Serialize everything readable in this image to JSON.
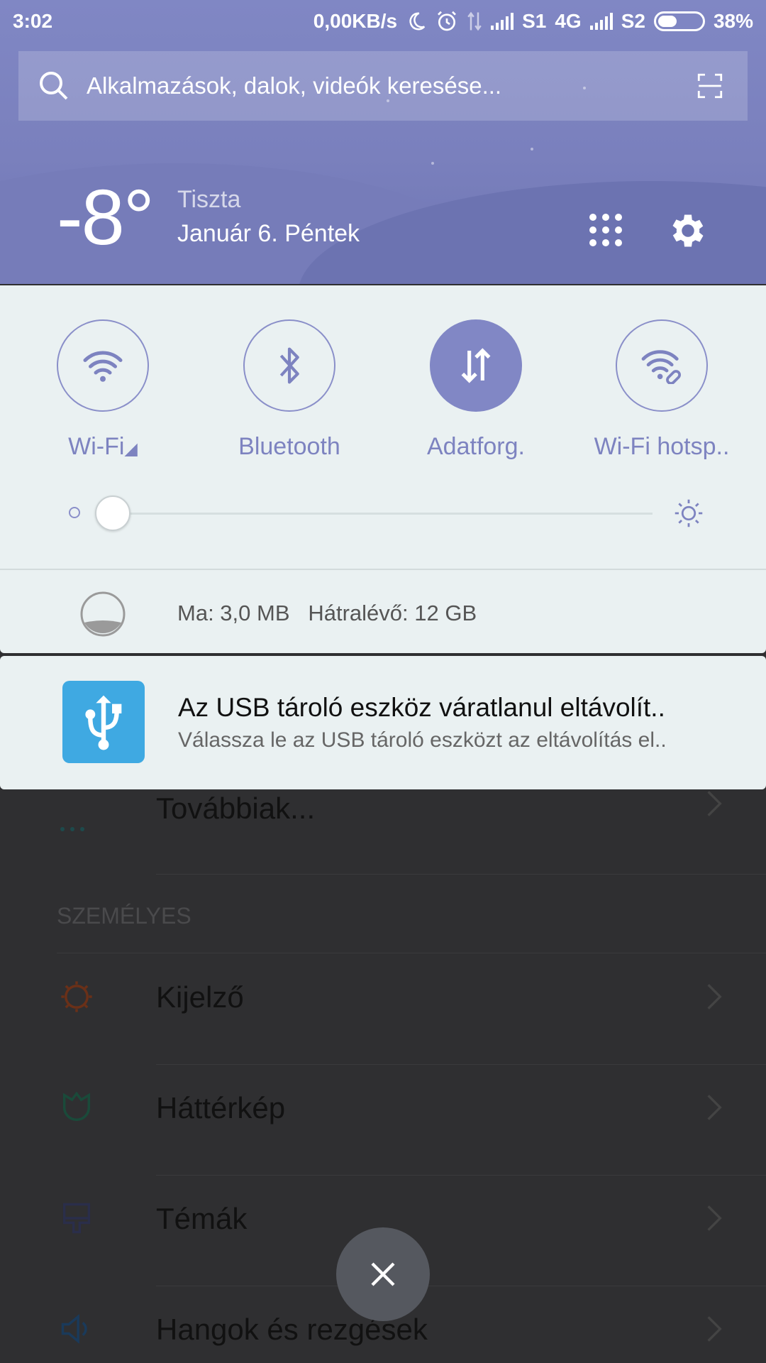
{
  "status_bar": {
    "time": "3:02",
    "net_speed": "0,00KB/s",
    "sim1": "S1",
    "network_type": "4G",
    "sim2": "S2",
    "battery": "38%",
    "battery_level": 0.38
  },
  "search": {
    "placeholder": "Alkalmazások, dalok, videók keresése..."
  },
  "weather": {
    "temperature": "-8°",
    "condition": "Tiszta",
    "date": "Január 6. Péntek"
  },
  "toggles": [
    {
      "label": "Wi-Fi",
      "icon": "wifi-icon",
      "active": false
    },
    {
      "label": "Bluetooth",
      "icon": "bluetooth-icon",
      "active": false
    },
    {
      "label": "Adatforg.",
      "icon": "data-transfer-icon",
      "active": true
    },
    {
      "label": "Wi-Fi hotsp..",
      "icon": "hotspot-icon",
      "active": false
    }
  ],
  "brightness": {
    "level": 0.0
  },
  "data_usage": {
    "today": "Ma: 3,0 MB",
    "remaining": "Hátralévő: 12 GB"
  },
  "notification": {
    "icon": "usb-icon",
    "title": "Az USB tároló eszköz váratlanul eltávolít..",
    "body": "Válassza le az USB tároló eszközt az eltávolítás el.."
  },
  "settings": {
    "more_label": "Továbbiak...",
    "section_personal": "SZEMÉLYES",
    "items": [
      {
        "label": "Kijelző",
        "icon": "display-icon"
      },
      {
        "label": "Háttérkép",
        "icon": "wallpaper-icon"
      },
      {
        "label": "Témák",
        "icon": "themes-icon"
      },
      {
        "label": "Hangok és rezgések",
        "icon": "sound-icon"
      }
    ]
  },
  "colors": {
    "accent": "#8187c5",
    "panel_bg": "#eaf1f2",
    "header_bg": "#7a80bd",
    "usb_icon_bg": "#3fa9e2"
  }
}
